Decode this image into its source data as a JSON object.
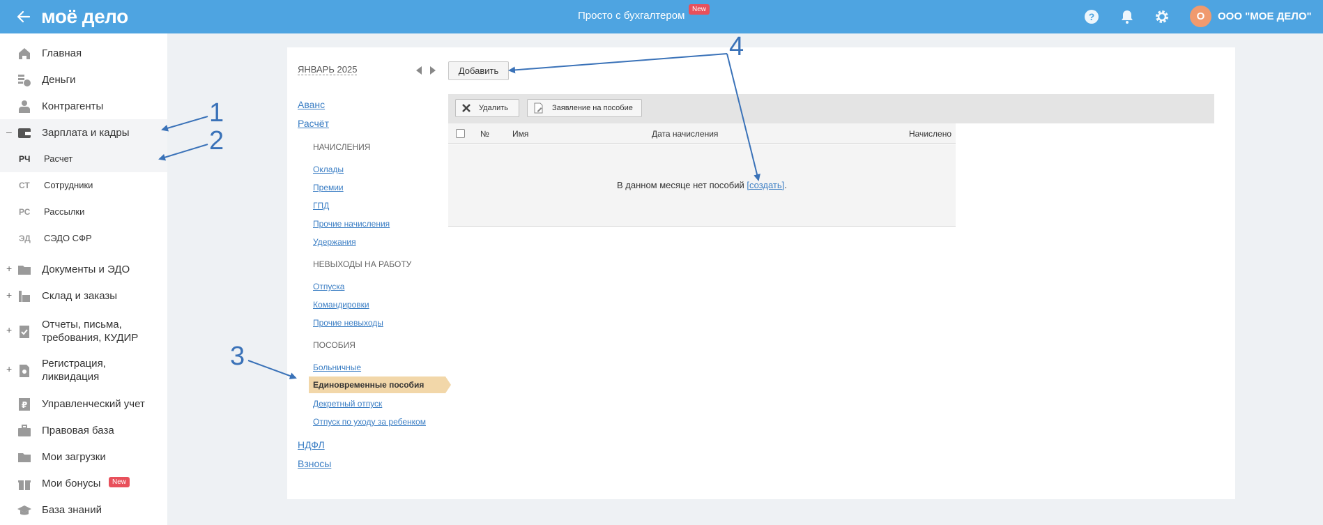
{
  "header": {
    "logo": "моё дело",
    "center_text": "Просто с бухгалтером",
    "center_badge": "New",
    "avatar_letter": "О",
    "company": "ООО \"МОЕ ДЕЛО\""
  },
  "sidebar": {
    "items": [
      {
        "label": "Главная",
        "icon": "home-icon"
      },
      {
        "label": "Деньги",
        "icon": "money-icon"
      },
      {
        "label": "Контрагенты",
        "icon": "contractors-icon"
      },
      {
        "label": "Зарплата и кадры",
        "icon": "wallet-icon",
        "expander": "–"
      },
      {
        "label": "Документы и ЭДО",
        "icon": "folder-icon",
        "expander": "+"
      },
      {
        "label": "Склад и заказы",
        "icon": "warehouse-icon",
        "expander": "+"
      },
      {
        "label": "Отчеты, письма,",
        "label2": "требования, КУДИР",
        "icon": "report-icon",
        "expander": "+"
      },
      {
        "label": "Регистрация,",
        "label2": "ликвидация",
        "icon": "registration-icon",
        "expander": "+"
      },
      {
        "label": "Управленческий учет",
        "icon": "ruble-icon"
      },
      {
        "label": "Правовая база",
        "icon": "briefcase-icon"
      },
      {
        "label": "Мои загрузки",
        "icon": "folder-icon"
      },
      {
        "label": "Мои бонусы",
        "icon": "gift-icon",
        "badge": "New"
      },
      {
        "label": "База знаний",
        "icon": "graduation-icon"
      }
    ],
    "sub_items": [
      {
        "abbr": "РЧ",
        "label": "Расчет"
      },
      {
        "abbr": "СТ",
        "label": "Сотрудники"
      },
      {
        "abbr": "РС",
        "label": "Рассылки"
      },
      {
        "abbr": "ЭД",
        "label": "СЭДО СФР"
      }
    ]
  },
  "period": {
    "month": "ЯНВАРЬ 2025"
  },
  "left_nav": {
    "avans": "Аванс",
    "raschet": "Расчёт",
    "group_accruals": "НАЧИСЛЕНИЯ",
    "accruals": [
      "Оклады",
      "Премии",
      "ГПД",
      "Прочие начисления",
      "Удержания"
    ],
    "group_absences": "НЕВЫХОДЫ НА РАБОТУ",
    "absences": [
      "Отпуска",
      "Командировки",
      "Прочие невыходы"
    ],
    "group_benefits": "ПОСОБИЯ",
    "benefits_before": [
      "Больничные"
    ],
    "benefits_active": "Единовременные пособия",
    "benefits_after": [
      "Декретный отпуск",
      "Отпуск по уходу за ребенком"
    ],
    "ndfl": "НДФЛ",
    "vznosy": "Взносы"
  },
  "toolbar": {
    "add": "Добавить",
    "delete": "Удалить",
    "application": "Заявление на пособие"
  },
  "table": {
    "columns": [
      "№",
      "Имя",
      "Дата начисления",
      "Начислено"
    ],
    "empty_prefix": "В данном месяце нет пособий ",
    "empty_link": "[создать]",
    "empty_suffix": "."
  },
  "annotations": [
    "1",
    "2",
    "3",
    "4"
  ],
  "colors": {
    "header": "#4ea4e1",
    "active_tab": "#f2d7a9",
    "link": "#3b7ec4",
    "annotation": "#3a72b8",
    "badge": "#e8505b"
  }
}
